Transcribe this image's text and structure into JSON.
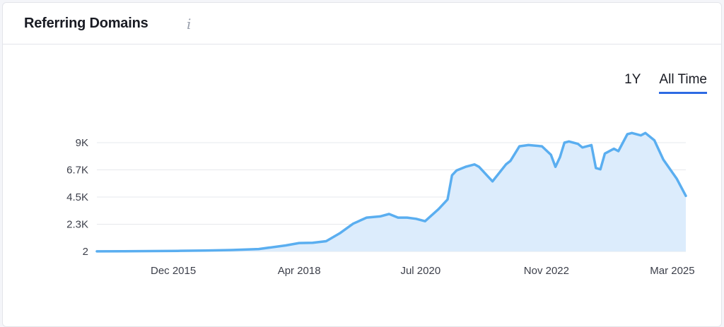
{
  "header": {
    "title": "Referring Domains",
    "info_icon": "info-icon"
  },
  "range_tabs": [
    {
      "label": "1Y",
      "active": false
    },
    {
      "label": "All Time",
      "active": true
    }
  ],
  "colors": {
    "line": "#5aaef0",
    "area": "#dcecfc",
    "grid": "#e6e8ec",
    "tab_underline": "#2d6ae3"
  },
  "chart_data": {
    "type": "area",
    "title": "Referring Domains",
    "xlabel": "",
    "ylabel": "",
    "xlim": [
      "2014-07",
      "2025-06"
    ],
    "ylim": [
      2,
      9000
    ],
    "grid": true,
    "legend": "none",
    "y_ticks": [
      {
        "value": 2,
        "label": "2"
      },
      {
        "value": 2250,
        "label": "2.3K"
      },
      {
        "value": 4500,
        "label": "4.5K"
      },
      {
        "value": 6750,
        "label": "6.7K"
      },
      {
        "value": 9000,
        "label": "9K"
      }
    ],
    "x_ticks": [
      {
        "date": "2015-12",
        "label": "Dec 2015"
      },
      {
        "date": "2018-04",
        "label": "Apr 2018"
      },
      {
        "date": "2020-07",
        "label": "Jul 2020"
      },
      {
        "date": "2022-11",
        "label": "Nov 2022"
      },
      {
        "date": "2025-03",
        "label": "Mar 2025"
      }
    ],
    "series": [
      {
        "x": [
          "2014-07",
          "2015-01",
          "2015-07",
          "2016-01",
          "2016-07",
          "2017-01",
          "2017-07",
          "2018-01",
          "2018-04",
          "2018-07",
          "2018-10",
          "2019-01",
          "2019-04",
          "2019-07",
          "2019-10",
          "2019-12",
          "2020-02",
          "2020-04",
          "2020-06",
          "2020-08",
          "2020-11",
          "2021-01",
          "2021-02",
          "2021-03",
          "2021-05",
          "2021-07",
          "2021-08",
          "2021-10",
          "2021-11",
          "2022-02",
          "2022-03",
          "2022-05",
          "2022-07",
          "2022-10",
          "2022-12",
          "2023-01",
          "2023-02",
          "2023-03",
          "2023-04",
          "2023-06",
          "2023-07",
          "2023-09",
          "2023-10",
          "2023-11",
          "2023-12",
          "2024-02",
          "2024-03",
          "2024-05",
          "2024-06",
          "2024-08",
          "2024-09",
          "2024-11",
          "2025-01",
          "2025-04",
          "2025-06"
        ],
        "values": [
          10,
          20,
          30,
          50,
          80,
          120,
          200,
          500,
          700,
          720,
          850,
          1500,
          2300,
          2800,
          2900,
          3100,
          2800,
          2800,
          2700,
          2500,
          3500,
          4300,
          6300,
          6700,
          7000,
          7200,
          7000,
          6200,
          5800,
          7200,
          7500,
          8700,
          8800,
          8700,
          8000,
          7000,
          7800,
          9000,
          9100,
          8900,
          8600,
          8800,
          6900,
          6800,
          8100,
          8500,
          8300,
          9700,
          9800,
          9600,
          9800,
          9200,
          7600,
          6000,
          4600
        ]
      }
    ]
  }
}
